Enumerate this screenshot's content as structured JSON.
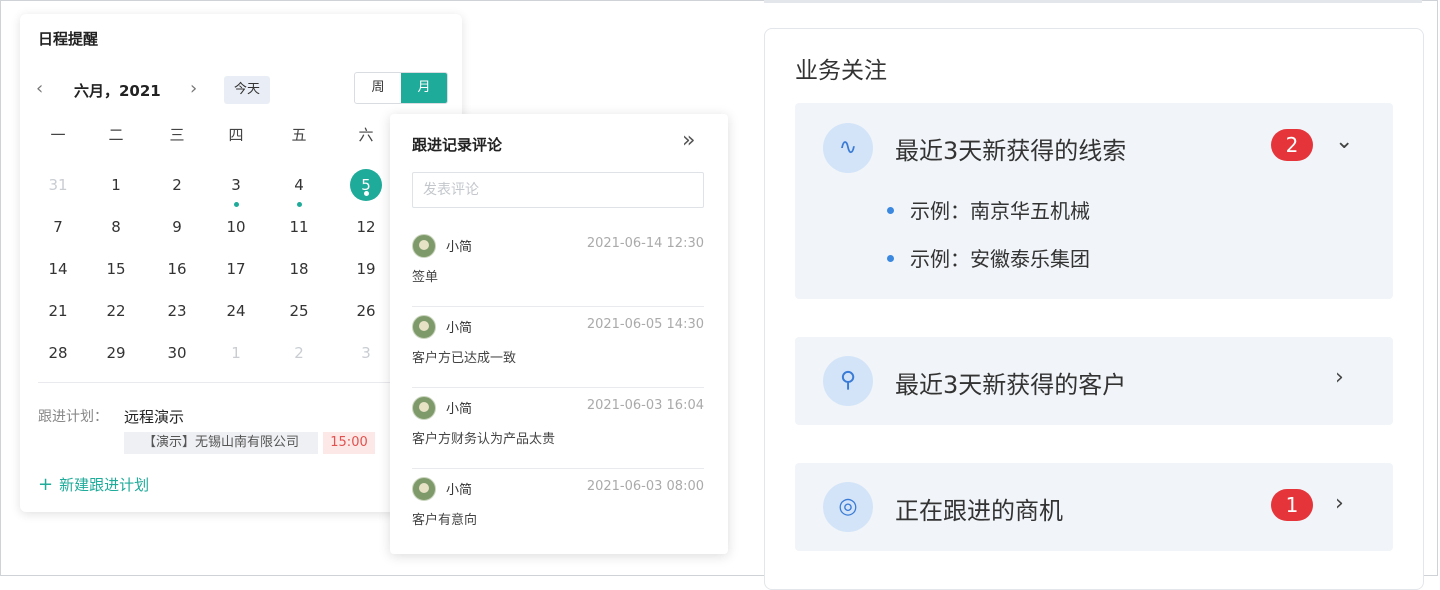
{
  "calendar": {
    "title": "日程提醒",
    "month_label": "六月，2021",
    "today_label": "今天",
    "view_week": "周",
    "view_month": "月",
    "active_view": "月",
    "weekdays": [
      "一",
      "二",
      "三",
      "四",
      "五",
      "六"
    ],
    "weeks": [
      [
        {
          "d": "31",
          "muted": true
        },
        {
          "d": "1"
        },
        {
          "d": "2"
        },
        {
          "d": "3",
          "dot": true
        },
        {
          "d": "4",
          "dot": true
        },
        {
          "d": "5",
          "selected": true,
          "dot": true
        }
      ],
      [
        {
          "d": "7"
        },
        {
          "d": "8"
        },
        {
          "d": "9"
        },
        {
          "d": "10"
        },
        {
          "d": "11"
        },
        {
          "d": "12"
        }
      ],
      [
        {
          "d": "14"
        },
        {
          "d": "15"
        },
        {
          "d": "16"
        },
        {
          "d": "17"
        },
        {
          "d": "18"
        },
        {
          "d": "19"
        }
      ],
      [
        {
          "d": "21"
        },
        {
          "d": "22"
        },
        {
          "d": "23"
        },
        {
          "d": "24"
        },
        {
          "d": "25"
        },
        {
          "d": "26"
        }
      ],
      [
        {
          "d": "28"
        },
        {
          "d": "29"
        },
        {
          "d": "30"
        },
        {
          "d": "1",
          "muted": true
        },
        {
          "d": "2",
          "muted": true
        },
        {
          "d": "3",
          "muted": true
        }
      ]
    ],
    "plan_label": "跟进计划：",
    "plan_title": "远程演示",
    "plan_company": "【演示】无锡山南有限公司",
    "plan_time": "15:00",
    "new_plan": "新建跟进计划"
  },
  "comments": {
    "title": "跟进记录评论",
    "input_placeholder": "发表评论",
    "items": [
      {
        "name": "小简",
        "time": "2021-06-14 12:30",
        "text": "签单"
      },
      {
        "name": "小简",
        "time": "2021-06-05 14:30",
        "text": "客户方已达成一致"
      },
      {
        "name": "小简",
        "time": "2021-06-03 16:04",
        "text": "客户方财务认为产品太贵"
      },
      {
        "name": "小简",
        "time": "2021-06-03 08:00",
        "text": "客户有意向"
      }
    ]
  },
  "business": {
    "title": "业务关注",
    "panels": [
      {
        "label": "最近3天新获得的线索",
        "badge": "2",
        "icon": "leads-icon",
        "expanded": true,
        "examples": [
          "示例：南京华五机械",
          "示例：安徽泰乐集团"
        ]
      },
      {
        "label": "最近3天新获得的客户",
        "badge": null,
        "icon": "customer-icon",
        "expanded": false
      },
      {
        "label": "正在跟进的商机",
        "badge": "1",
        "icon": "opportunity-icon",
        "expanded": false
      }
    ]
  },
  "colors": {
    "accent": "#1fab9a",
    "badge_red": "#e5353a",
    "icon_blue": "#3a7bd5"
  }
}
